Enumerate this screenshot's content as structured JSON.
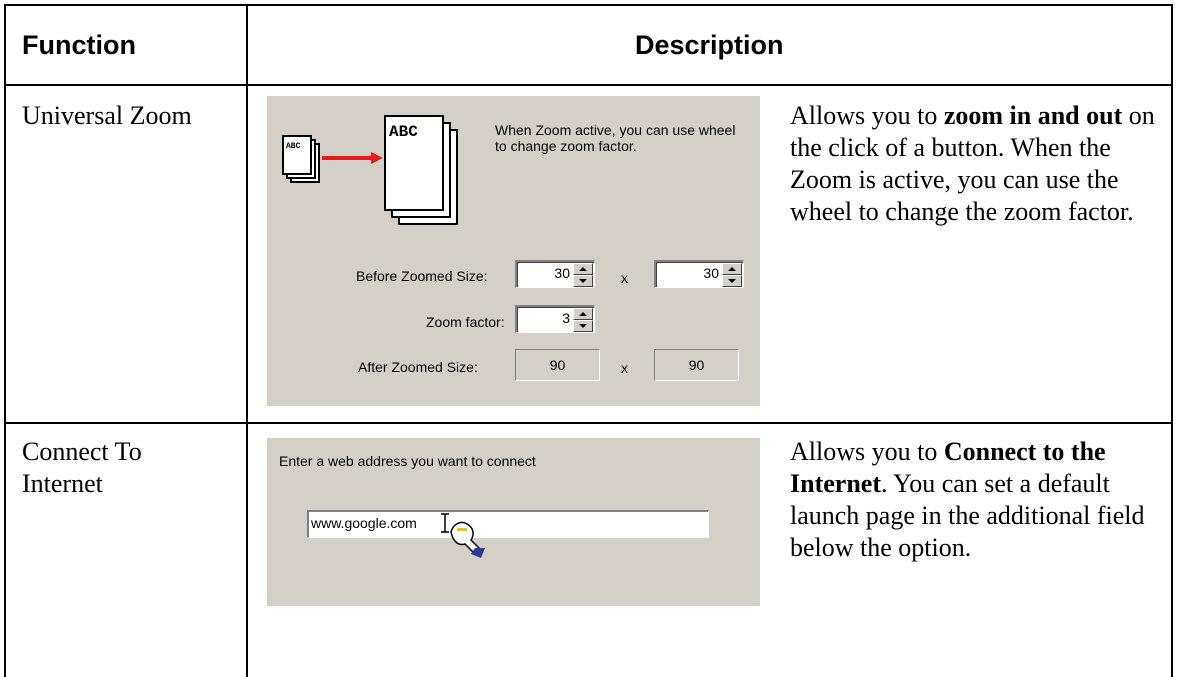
{
  "table": {
    "headers": {
      "function": "Function",
      "description": "Description"
    },
    "rows": [
      {
        "function": "Universal Zoom",
        "dialog": {
          "icon_small_text": "ABC",
          "icon_large_text": "ABC",
          "hint": "When Zoom active, you can use wheel to change zoom factor.",
          "before_label": "Before Zoomed Size:",
          "before_width": "30",
          "before_height": "30",
          "times_1": "x",
          "factor_label": "Zoom factor:",
          "factor_value": "3",
          "after_label": "After Zoomed Size:",
          "after_width": "90",
          "after_height": "90",
          "times_2": "x"
        },
        "desc": {
          "p1": "Allows you to ",
          "b1": "zoom in and out",
          "p2": " on the click of a button. When the Zoom is active, you can use the wheel to change the zoom factor."
        }
      },
      {
        "function": "Connect To Internet",
        "dialog": {
          "prompt": "Enter a web address you want to connect",
          "url_value": "www.google.com"
        },
        "desc": {
          "p1": "Allows you to ",
          "b1": "Connect to the Internet",
          "p2": ". You can set a default launch page in the additional field below the option."
        }
      }
    ]
  },
  "colors": {
    "dialog_bg": "#d4d0c8",
    "arrow": "#e81a1a",
    "cursor_accent": "#2a3a9a"
  }
}
